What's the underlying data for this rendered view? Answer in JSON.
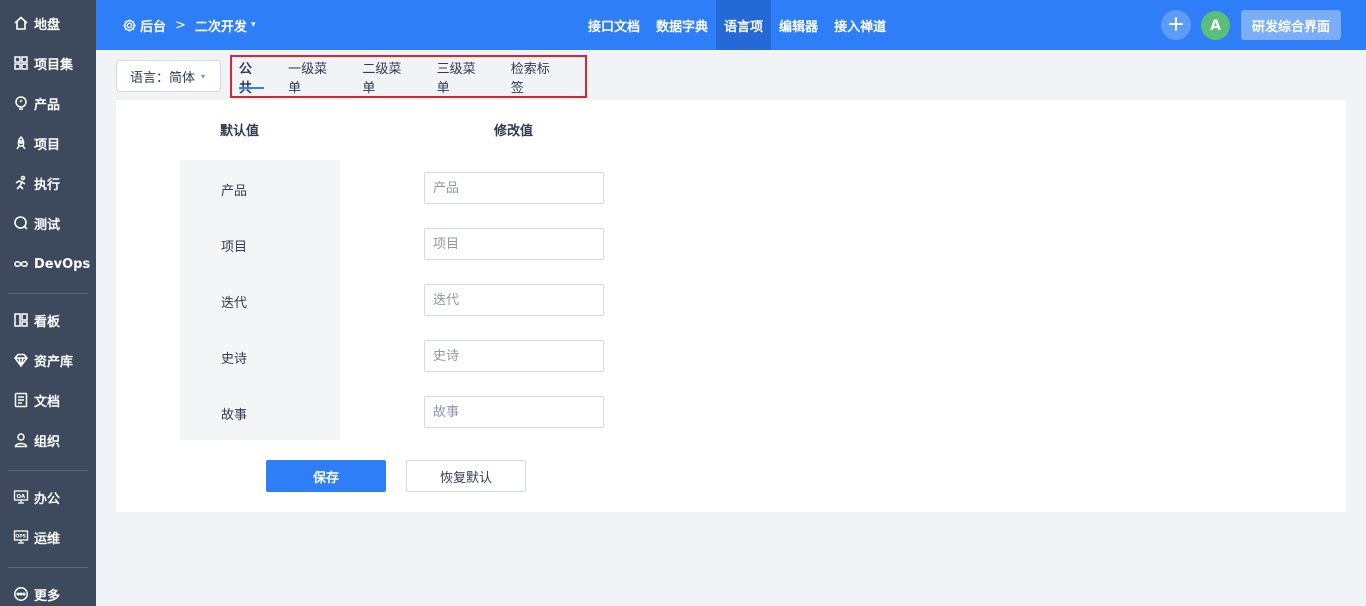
{
  "sidebar": {
    "items": [
      {
        "label": "地盘",
        "icon": "home-icon"
      },
      {
        "label": "项目集",
        "icon": "grid-icon"
      },
      {
        "label": "产品",
        "icon": "lightbulb-icon"
      },
      {
        "label": "项目",
        "icon": "rocket-icon"
      },
      {
        "label": "执行",
        "icon": "run-icon"
      },
      {
        "label": "测试",
        "icon": "test-icon"
      },
      {
        "label": "DevOps",
        "icon": "infinity-icon"
      },
      {
        "label": "看板",
        "icon": "kanban-icon"
      },
      {
        "label": "资产库",
        "icon": "diamond-icon"
      },
      {
        "label": "文档",
        "icon": "document-icon"
      },
      {
        "label": "组织",
        "icon": "user-icon"
      },
      {
        "label": "办公",
        "icon": "oa-icon"
      },
      {
        "label": "运维",
        "icon": "ops-icon"
      },
      {
        "label": "更多",
        "icon": "more-icon"
      }
    ]
  },
  "header": {
    "breadcrumb": {
      "root": "后台",
      "separator": ">",
      "current": "二次开发",
      "caret": "▾"
    },
    "nav": [
      "接口文档",
      "数据字典",
      "语言项",
      "编辑器",
      "接入禅道"
    ],
    "active_nav": "语言项",
    "plus_label": "+",
    "avatar_letter": "A",
    "portal_label": "研发综合界面"
  },
  "toolbar": {
    "language_select": "语言：简体",
    "caret": "▾",
    "tabs": [
      "公共",
      "一级菜单",
      "二级菜单",
      "三级菜单",
      "检索标签"
    ],
    "active_tab": "公共"
  },
  "form": {
    "default_header": "默认值",
    "edit_header": "修改值",
    "rows": [
      {
        "default": "产品",
        "placeholder": "产品"
      },
      {
        "default": "项目",
        "placeholder": "项目"
      },
      {
        "default": "迭代",
        "placeholder": "迭代"
      },
      {
        "default": "史诗",
        "placeholder": "史诗"
      },
      {
        "default": "故事",
        "placeholder": "故事"
      }
    ],
    "save_label": "保存",
    "reset_label": "恢复默认"
  },
  "colors": {
    "header_bg": "#2e7ff7",
    "sidebar_bg": "#3d4a5e",
    "highlight_border": "#d6262f"
  }
}
